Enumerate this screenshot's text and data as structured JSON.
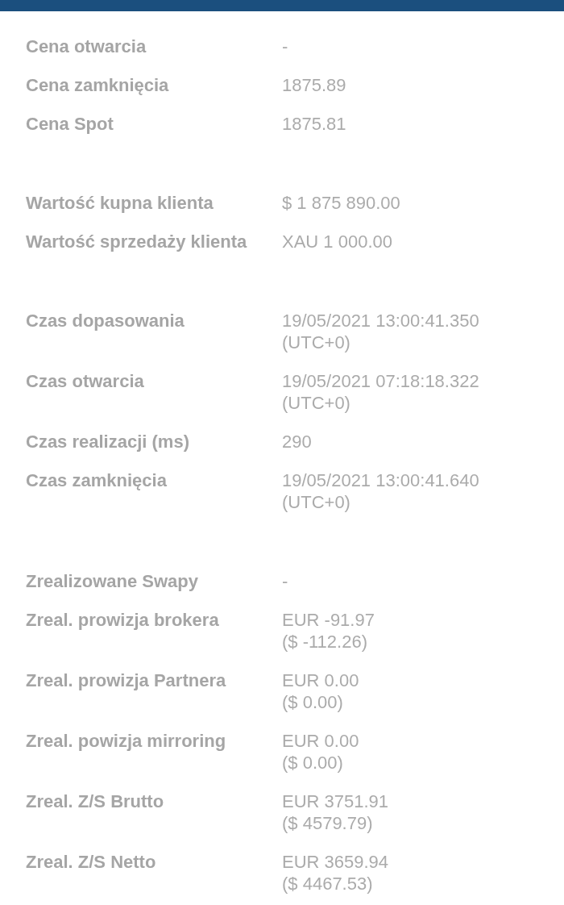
{
  "sections": [
    {
      "rows": [
        {
          "label": "Cena otwarcia",
          "value": [
            "-"
          ]
        },
        {
          "label": "Cena zamknięcia",
          "value": [
            "1875.89"
          ]
        },
        {
          "label": "Cena Spot",
          "value": [
            "1875.81"
          ]
        }
      ]
    },
    {
      "rows": [
        {
          "label": "Wartość kupna klienta",
          "value": [
            "$ 1 875 890.00"
          ]
        },
        {
          "label": "Wartość sprzedaży klienta",
          "value": [
            "XAU 1 000.00"
          ]
        }
      ]
    },
    {
      "rows": [
        {
          "label": "Czas dopasowania",
          "value": [
            "19/05/2021 13:00:41.350",
            "(UTC+0)"
          ]
        },
        {
          "label": "Czas otwarcia",
          "value": [
            "19/05/2021 07:18:18.322",
            "(UTC+0)"
          ]
        },
        {
          "label": "Czas realizacji (ms)",
          "value": [
            "290"
          ]
        },
        {
          "label": "Czas zamknięcia",
          "value": [
            "19/05/2021 13:00:41.640",
            "(UTC+0)"
          ]
        }
      ]
    },
    {
      "rows": [
        {
          "label": "Zrealizowane Swapy",
          "value": [
            "-"
          ]
        },
        {
          "label": "Zreal. prowizja brokera",
          "value": [
            "EUR -91.97",
            "($ -112.26)"
          ]
        },
        {
          "label": "Zreal. prowizja Partnera",
          "value": [
            "EUR 0.00",
            "($ 0.00)"
          ]
        },
        {
          "label": "Zreal. powizja mirroring",
          "value": [
            "EUR 0.00",
            "($ 0.00)"
          ]
        },
        {
          "label": "Zreal. Z/S Brutto",
          "value": [
            "EUR 3751.91",
            "($ 4579.79)"
          ]
        },
        {
          "label": "Zreal. Z/S Netto",
          "value": [
            "EUR 3659.94",
            "($ 4467.53)"
          ]
        }
      ]
    }
  ]
}
